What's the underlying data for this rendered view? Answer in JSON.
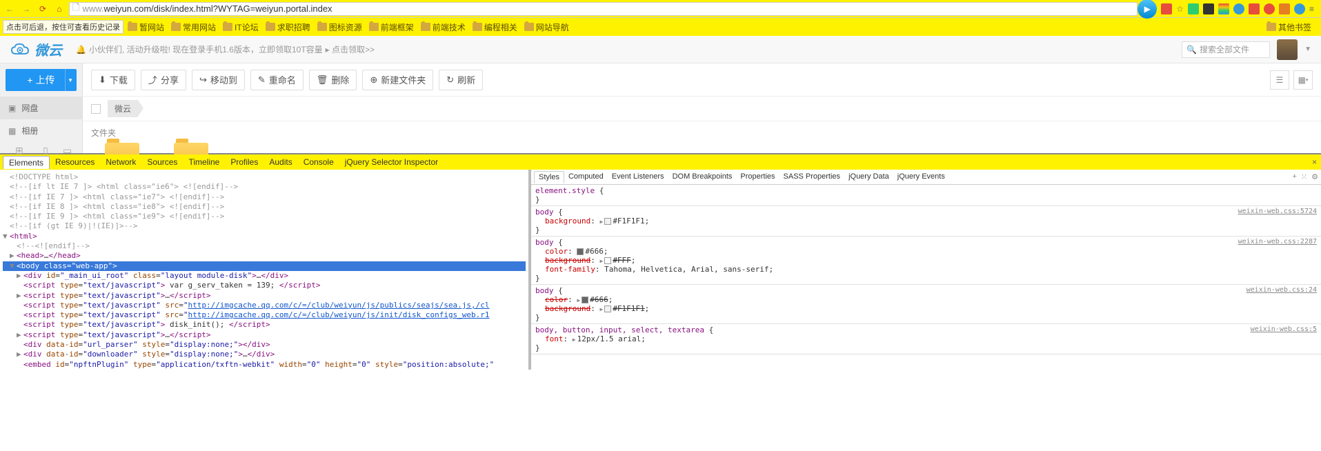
{
  "browser": {
    "url_scheme": "www.",
    "url_rest": "weiyun.com/disk/index.html?WYTAG=weiyun.portal.index",
    "history_tip": "点击可后退，按住可查看历史记录",
    "other_bookmarks": "其他书签"
  },
  "bookmarks": [
    "暂网站",
    "常用网站",
    "IT论坛",
    "求职招聘",
    "图标资源",
    "前端框架",
    "前端技术",
    "编程相关",
    "网站导航"
  ],
  "header": {
    "logo": "微云",
    "notice_pre": "小伙伴们, 活动升级啦! 现在登录手机1.6版本，立即领取10T容量",
    "notice_link": "▸ 点击领取>>",
    "search_placeholder": "搜索全部文件"
  },
  "sidebar": {
    "upload": "上传",
    "items": [
      "网盘",
      "相册"
    ],
    "platforms": [
      "Android",
      "iPhone",
      "iPad"
    ]
  },
  "toolbar": {
    "buttons": [
      "下载",
      "分享",
      "移动到",
      "重命名",
      "删除",
      "新建文件夹",
      "刷新"
    ]
  },
  "breadcrumb": "微云",
  "section_folder": "文件夹",
  "devtools": {
    "tabs": [
      "Elements",
      "Resources",
      "Network",
      "Sources",
      "Timeline",
      "Profiles",
      "Audits",
      "Console",
      "jQuery Selector Inspector"
    ],
    "style_tabs": [
      "Styles",
      "Computed",
      "Event Listeners",
      "DOM Breakpoints",
      "Properties",
      "SASS Properties",
      "jQuery Data",
      "jQuery Events"
    ],
    "elements_lines": [
      {
        "indent": 0,
        "type": "cm",
        "text": "<!DOCTYPE html>"
      },
      {
        "indent": 0,
        "type": "cm",
        "text": "<!--[if lt IE 7 ]> <html class=\"ie6\"> <![endif]-->"
      },
      {
        "indent": 0,
        "type": "cm",
        "text": "<!--[if IE 7 ]> <html class=\"ie7\"> <![endif]-->"
      },
      {
        "indent": 0,
        "type": "cm",
        "text": "<!--[if IE 8 ]> <html class=\"ie8\"> <![endif]-->"
      },
      {
        "indent": 0,
        "type": "cm",
        "text": "<!--[if IE 9 ]> <html class=\"ie9\"> <![endif]-->"
      },
      {
        "indent": 0,
        "type": "cm",
        "text": "<!--[if (gt IE 9)|!(IE)]>-->"
      },
      {
        "indent": 0,
        "type": "tag",
        "arrow": "▼",
        "html": "<span class='tag'>&lt;html&gt;</span>"
      },
      {
        "indent": 1,
        "type": "cm",
        "text": "<!--<![endif]-->"
      },
      {
        "indent": 1,
        "type": "tag",
        "arrow": "▶",
        "html": "<span class='tag'>&lt;head&gt;</span>…<span class='tag'>&lt;/head&gt;</span>"
      },
      {
        "indent": 1,
        "type": "selected",
        "arrow": "▼",
        "html": "<span class='tag'>&lt;body</span> <span class='attr'>class</span>=<span class='val'>\"web-app\"</span><span class='tag'>&gt;</span>"
      },
      {
        "indent": 2,
        "type": "tag",
        "arrow": "▶",
        "html": "<span class='tag'>&lt;div</span> <span class='attr'>id</span>=<span class='val'>\"_main_ui_root\"</span> <span class='attr'>class</span>=<span class='val'>\"layout module-disk\"</span><span class='tag'>&gt;</span>…<span class='tag'>&lt;/div&gt;</span>"
      },
      {
        "indent": 2,
        "type": "tag",
        "arrow": "",
        "html": "<span class='tag'>&lt;script</span> <span class='attr'>type</span>=<span class='val'>\"text/javascript\"</span><span class='tag'>&gt;</span> var g_serv_taken = 139; <span class='tag'>&lt;/script&gt;</span>"
      },
      {
        "indent": 2,
        "type": "tag",
        "arrow": "▶",
        "html": "<span class='tag'>&lt;script</span> <span class='attr'>type</span>=<span class='val'>\"text/javascript\"</span><span class='tag'>&gt;</span>…<span class='tag'>&lt;/script&gt;</span>"
      },
      {
        "indent": 2,
        "type": "tag",
        "arrow": "",
        "html": "<span class='tag'>&lt;script</span> <span class='attr'>type</span>=<span class='val'>\"text/javascript\"</span> <span class='attr'>src</span>=<span class='val'>\"</span><span class='link'>http://imgcache.qq.com/c/=/club/weiyun/js/publics/seajs/sea.js,/cl</span>"
      },
      {
        "indent": 2,
        "type": "tag",
        "arrow": "",
        "html": "<span class='tag'>&lt;script</span> <span class='attr'>type</span>=<span class='val'>\"text/javascript\"</span> <span class='attr'>src</span>=<span class='val'>\"</span><span class='link'>http://imgcache.qq.com/c/=/club/weiyun/js/init/disk_configs_web.r1</span>"
      },
      {
        "indent": 2,
        "type": "tag",
        "arrow": "",
        "html": "<span class='tag'>&lt;script</span> <span class='attr'>type</span>=<span class='val'>\"text/javascript\"</span><span class='tag'>&gt;</span> disk_init(); <span class='tag'>&lt;/script&gt;</span>"
      },
      {
        "indent": 2,
        "type": "tag",
        "arrow": "▶",
        "html": "<span class='tag'>&lt;script</span> <span class='attr'>type</span>=<span class='val'>\"text/javascript\"</span><span class='tag'>&gt;</span>…<span class='tag'>&lt;/script&gt;</span>"
      },
      {
        "indent": 2,
        "type": "tag",
        "arrow": "",
        "html": "<span class='tag'>&lt;div</span> <span class='attr'>data-id</span>=<span class='val'>\"url_parser\"</span> <span class='attr'>style</span>=<span class='val'>\"display:none;\"</span><span class='tag'>&gt;&lt;/div&gt;</span>"
      },
      {
        "indent": 2,
        "type": "tag",
        "arrow": "▶",
        "html": "<span class='tag'>&lt;div</span> <span class='attr'>data-id</span>=<span class='val'>\"downloader\"</span> <span class='attr'>style</span>=<span class='val'>\"display:none;\"</span><span class='tag'>&gt;</span>…<span class='tag'>&lt;/div&gt;</span>"
      },
      {
        "indent": 2,
        "type": "tag",
        "arrow": "",
        "html": "<span class='tag'>&lt;embed</span> <span class='attr'>id</span>=<span class='val'>\"npftnPlugin\"</span> <span class='attr'>type</span>=<span class='val'>\"application/txftn-webkit\"</span> <span class='attr'>width</span>=<span class='val'>\"0\"</span> <span class='attr'>height</span>=<span class='val'>\"0\"</span> <span class='attr'>style</span>=<span class='val'>\"position:absolute;\"</span>"
      }
    ],
    "styles": [
      {
        "src": "",
        "sel": "element.style {",
        "props": [],
        "close": "}"
      },
      {
        "src": "weixin-web.css:5724",
        "sel": "body {",
        "props": [
          {
            "n": "background",
            "v": "#F1F1F1",
            "swatch": "#F1F1F1",
            "tri": true
          }
        ],
        "close": "}"
      },
      {
        "src": "weixin-web.css:2287",
        "sel": "body {",
        "props": [
          {
            "n": "color",
            "v": "#666",
            "swatch": "#666"
          },
          {
            "n": "background",
            "v": "#FFF",
            "swatch": "#FFF",
            "strike": true,
            "tri": true
          },
          {
            "n": "font-family",
            "v": "Tahoma, Helvetica, Arial, sans-serif"
          }
        ],
        "close": "}"
      },
      {
        "src": "weixin-web.css:24",
        "sel": "body {",
        "props": [
          {
            "n": "color",
            "v": "#666",
            "swatch": "#666",
            "strike": true,
            "tri": true
          },
          {
            "n": "background",
            "v": "#F1F1F1",
            "swatch": "#F1F1F1",
            "strike": true,
            "tri": true
          }
        ],
        "close": "}"
      },
      {
        "src": "weixin-web.css:5",
        "sel": "body, button, input, select, textarea {",
        "props": [
          {
            "n": "font",
            "v": "12px/1.5 arial",
            "tri": true
          }
        ],
        "close": "}"
      }
    ]
  }
}
